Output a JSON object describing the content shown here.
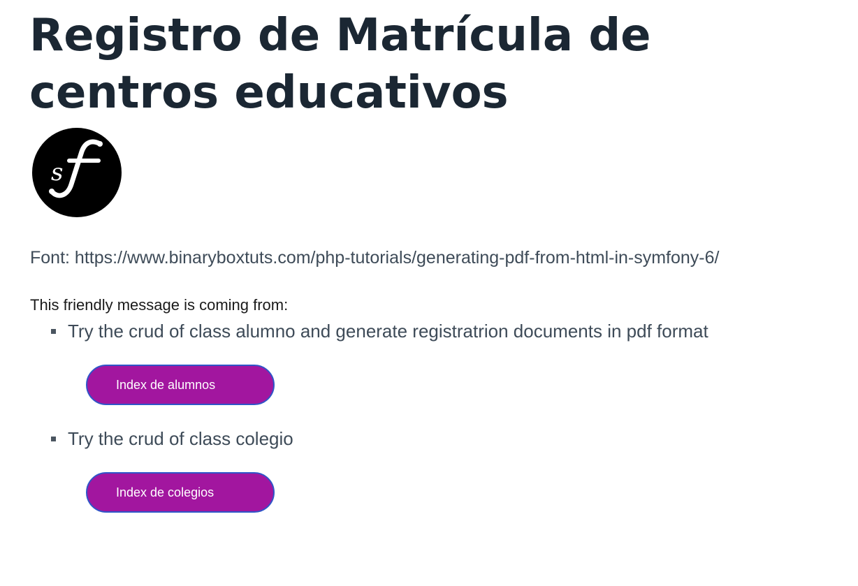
{
  "header": {
    "title": "Registro de Matrícula de centros educativos"
  },
  "logo": {
    "icon": "symfony-logo-icon",
    "letters": "sf"
  },
  "source": {
    "text": "Font: https://www.binaryboxtuts.com/php-tutorials/generating-pdf-from-html-in-symfony-6/"
  },
  "intro": {
    "text": "This friendly message is coming from:"
  },
  "items": [
    {
      "text": "Try the crud of class alumno and generate registratrion documents in pdf format",
      "button_label": "Index de alumnos"
    },
    {
      "text": "Try the crud of class colegio",
      "button_label": "Index de colegios"
    }
  ],
  "colors": {
    "title": "#1b2733",
    "text": "#3e4b58",
    "button_bg": "#a2169f",
    "button_border": "#2f55c8",
    "button_text": "#ffffff"
  }
}
